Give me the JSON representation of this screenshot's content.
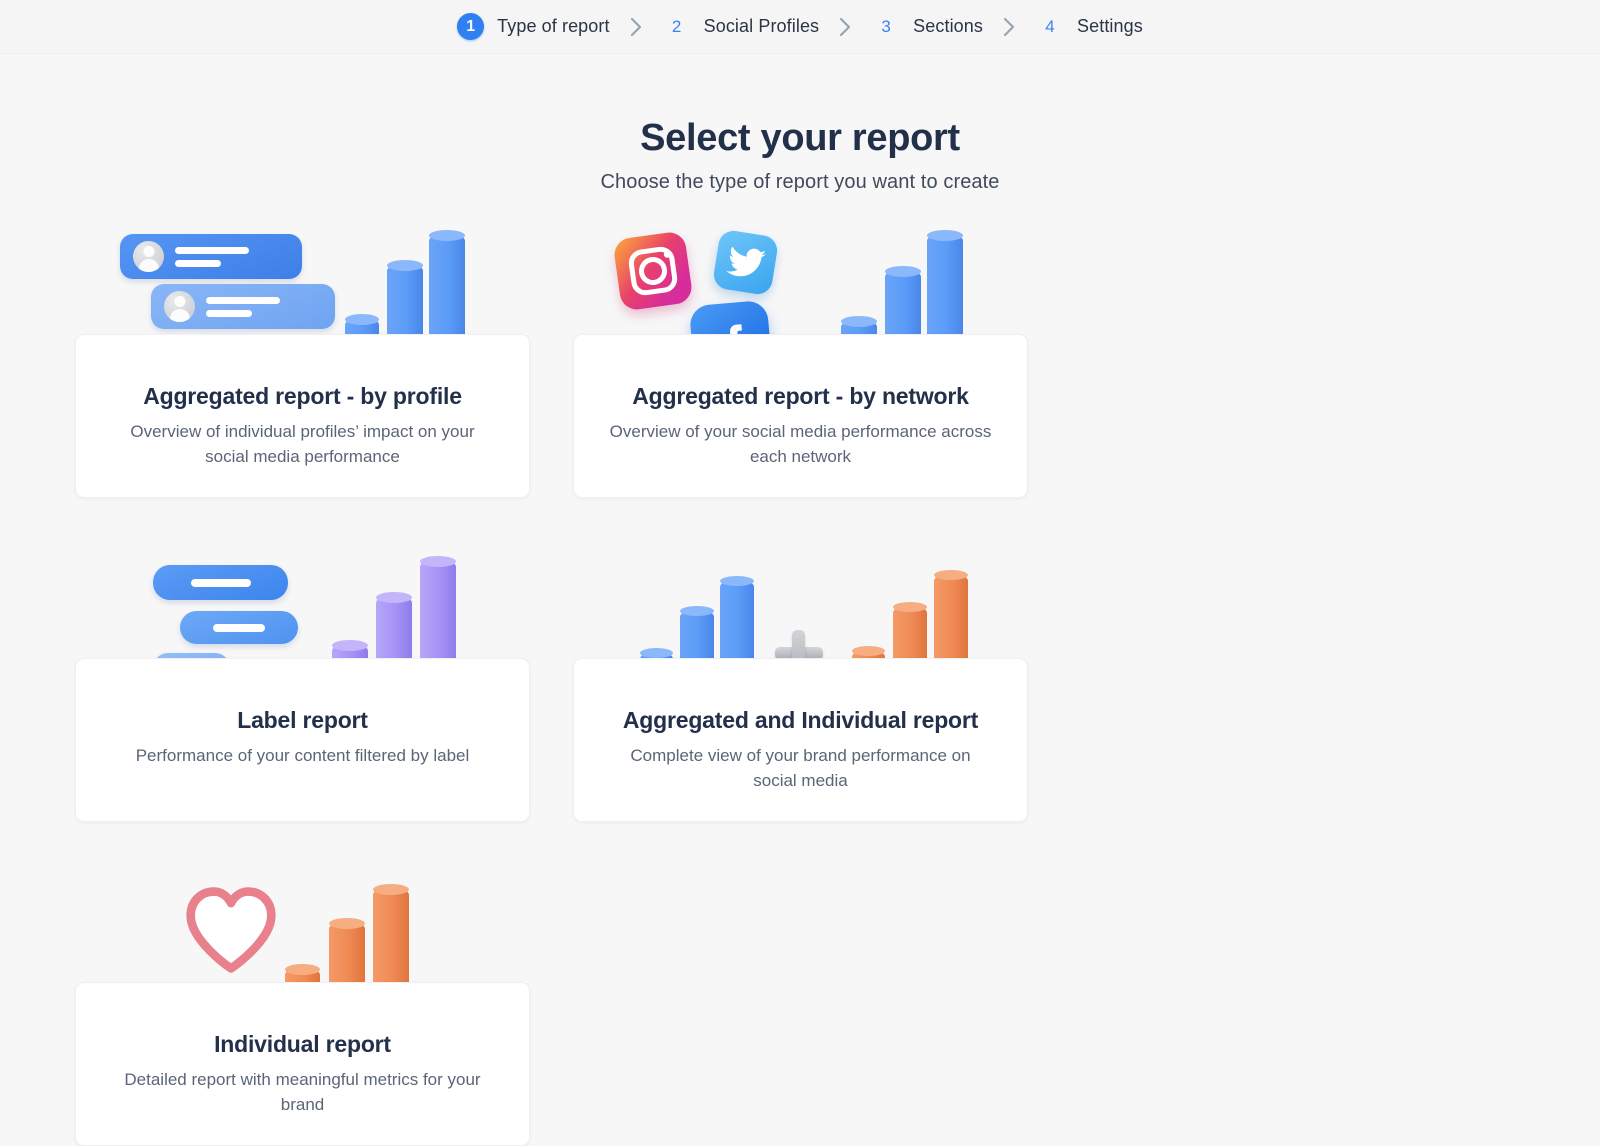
{
  "stepper": {
    "separator_icon": "chevron-right-icon",
    "steps": [
      {
        "number": "1",
        "label": "Type of report",
        "active": true
      },
      {
        "number": "2",
        "label": "Social Profiles",
        "active": false
      },
      {
        "number": "3",
        "label": "Sections",
        "active": false
      },
      {
        "number": "4",
        "label": "Settings",
        "active": false
      }
    ]
  },
  "header": {
    "title": "Select your report",
    "subtitle": "Choose the type of report you want to create"
  },
  "cards": [
    {
      "title": "Aggregated report - by profile",
      "description": "Overview of individual profiles’ impact on your social media performance",
      "art": "profiles-and-blue-bar-chart-illustration"
    },
    {
      "title": "Aggregated report - by network",
      "description": "Overview of your social media performance across each network",
      "art": "social-networks-and-blue-bar-chart-illustration"
    },
    {
      "title": "Label report",
      "description": "Performance of your content filtered by label",
      "art": "labels-and-purple-bar-chart-illustration"
    },
    {
      "title": "Aggregated and Individual report",
      "description": "Complete view of your brand performance on social media",
      "art": "blue-plus-orange-bar-charts-illustration"
    },
    {
      "title": "Individual report",
      "description": "Detailed report with meaningful metrics for your brand",
      "art": "heart-and-orange-bar-chart-illustration"
    }
  ],
  "colors": {
    "page_background": "#f7f7f8",
    "stepbar_background": "#f5f5f6",
    "accent_blue": "#2f80f0",
    "step_number_blue": "#3b82f6",
    "title_navy": "#23304a",
    "body_grey": "#5b6577",
    "card_white": "#ffffff",
    "chart_blue": "#5b9cf8",
    "chart_blue_disc": "#b9d3f6",
    "chart_purple": "#a593f5",
    "chart_purple_disc": "#ddd6f5",
    "chart_orange": "#f08a54",
    "chart_orange_disc": "#f1c7ae",
    "heart_pink": "#e8818c",
    "instagram_gradient": "#e1306c",
    "twitter_blue": "#4ab3f4",
    "facebook_blue": "#1877f2",
    "plus_grey": "#c3c6cb"
  }
}
